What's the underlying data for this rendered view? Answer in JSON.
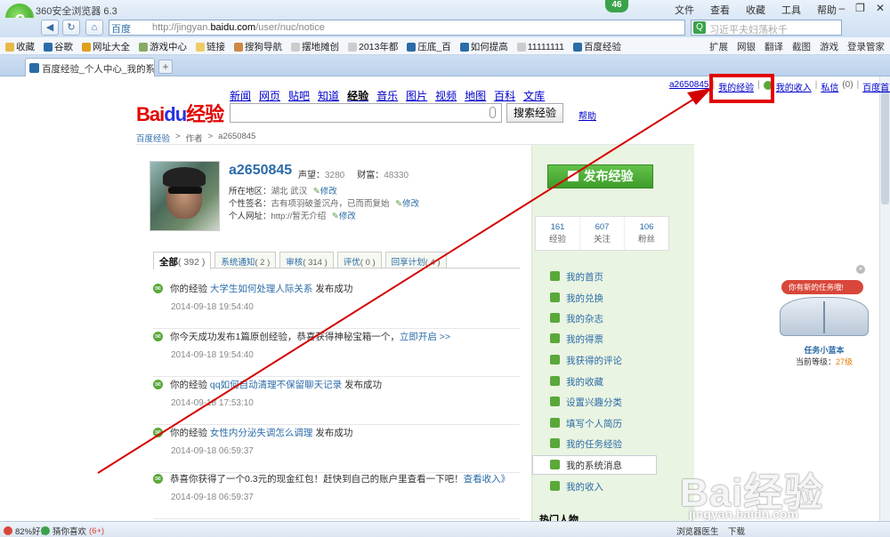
{
  "browser": {
    "title": "360安全浏览器 6.3",
    "menus": [
      "文件",
      "查看",
      "收藏",
      "工具",
      "帮助"
    ],
    "notify_count": "46",
    "engine": "百度",
    "url_prefix": "http://jingyan.",
    "url_domain": "baidu.com",
    "url_suffix": "/user/nuc/notice",
    "search_placeholder": "习近平夫妇荡秋千",
    "favorites": [
      "收藏",
      "谷歌",
      "网址大全",
      "游戏中心",
      "链接",
      "搜狗导航",
      "摆地摊创",
      "2013年都",
      "压底_百",
      "如何提高",
      "11111111",
      "百度经验"
    ],
    "toolbar_right": [
      "扩展",
      "网银",
      "翻译",
      "截图",
      "游戏",
      "登录管家"
    ],
    "tab_title": "百度经验_个人中心_我的系统消...",
    "status_left1": "82%好评",
    "status_left2": "猜你喜欢",
    "status_left2_count": "(6+)",
    "status_right1": "浏览器医生",
    "status_right2": "下载"
  },
  "baidu": {
    "logo_bai": "Bai",
    "logo_du": "du",
    "logo_jy": "经验",
    "nav": [
      "新闻",
      "网页",
      "贴吧",
      "知道",
      "经验",
      "音乐",
      "图片",
      "视频",
      "地图",
      "百科",
      "文库"
    ],
    "nav_current": "经验",
    "search_button": "搜索经验",
    "help": "帮助",
    "top_user": "a2650845",
    "top_links": [
      "我的经验",
      "我的收入",
      "私信",
      "(0)",
      "百度首页"
    ]
  },
  "breadcrumb": [
    "百度经验",
    ">",
    "作者",
    ">",
    "a2650845"
  ],
  "profile": {
    "username": "a2650845",
    "fame_label": "声望：",
    "fame_value": "3280",
    "wealth_label": "财富：",
    "wealth_value": "48330",
    "location_label": "所在地区：",
    "location_value": "湖北 武汉",
    "sign_label": "个性签名：",
    "sign_value": "古有项羽破釜沉舟，已而而复始",
    "site_label": "个人网址：",
    "site_value": "http://暂无介绍",
    "edit": "修改"
  },
  "tabs": [
    {
      "label": "全部",
      "count": "( 392 )"
    },
    {
      "label": "系统通知",
      "count": "( 2 )"
    },
    {
      "label": "审核",
      "count": "( 314 )"
    },
    {
      "label": "评优",
      "count": "( 0 )"
    },
    {
      "label": "回享计划",
      "count": "( 4 )"
    }
  ],
  "feed": [
    {
      "pre": "你的经验 ",
      "link": "大学生如何处理人际关系",
      "post": " 发布成功",
      "time": "2014-09-18 19:54:40"
    },
    {
      "pre": "你今天成功发布1篇原创经验，恭喜获得神秘宝箱一个，",
      "link": "立即开启 >>",
      "post": "",
      "time": "2014-09-18 19:54:40"
    },
    {
      "pre": "你的经验 ",
      "link": "qq如何自动清理不保留聊天记录",
      "post": " 发布成功",
      "time": "2014-09-18 17:53:10"
    },
    {
      "pre": "你的经验 ",
      "link": "女性内分泌失调怎么调理",
      "post": " 发布成功",
      "time": "2014-09-18 06:59:37"
    },
    {
      "pre": "恭喜你获得了一个0.3元的现金红包！赶快到自己的账户里查看一下吧！",
      "link": "查看收入》",
      "post": "",
      "time": "2014-09-18 06:59:37"
    }
  ],
  "side": {
    "publish": "发布经验",
    "counts": [
      {
        "n": "161",
        "l": "经验"
      },
      {
        "n": "607",
        "l": "关注"
      },
      {
        "n": "106",
        "l": "粉丝"
      }
    ],
    "menu": [
      "我的首页",
      "我的兑换",
      "我的杂志",
      "我的得票",
      "我获得的评论",
      "我的收藏",
      "设置兴趣分类",
      "填写个人简历",
      "我的任务经验",
      "我的系统消息",
      "我的收入"
    ],
    "menu_selected": "我的系统消息",
    "hot": "热门人物"
  },
  "task": {
    "bubble": "你有新的任务哦!",
    "title": "任务小蓝本",
    "level_label": "当前等级：",
    "level_value": "27级"
  },
  "watermark": {
    "text": "Bai经验",
    "url": "jingyan.baidu.com"
  }
}
